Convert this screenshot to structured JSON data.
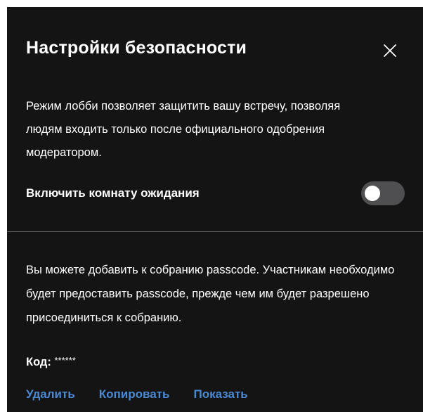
{
  "dialog": {
    "title": "Настройки безопасности",
    "close_icon": "close-icon"
  },
  "lobby": {
    "description": "Режим лобби позволяет защитить вашу встречу, позволяя людям входить только после официального одобрения модератором.",
    "toggle_label": "Включить комнату ожидания",
    "toggle_enabled": false
  },
  "passcode": {
    "description": "Вы можете добавить к собранию passcode. Участникам необходимо будет предоставить passcode, прежде чем им будет разрешено присоединиться к собранию.",
    "code_label": "Код:",
    "code_value": "******",
    "actions": {
      "delete": "Удалить",
      "copy": "Копировать",
      "show": "Показать"
    }
  },
  "colors": {
    "background": "#141414",
    "text": "#ffffff",
    "link": "#4a8ad4",
    "toggle_off": "#4f4f52",
    "divider": "#5f6066"
  }
}
